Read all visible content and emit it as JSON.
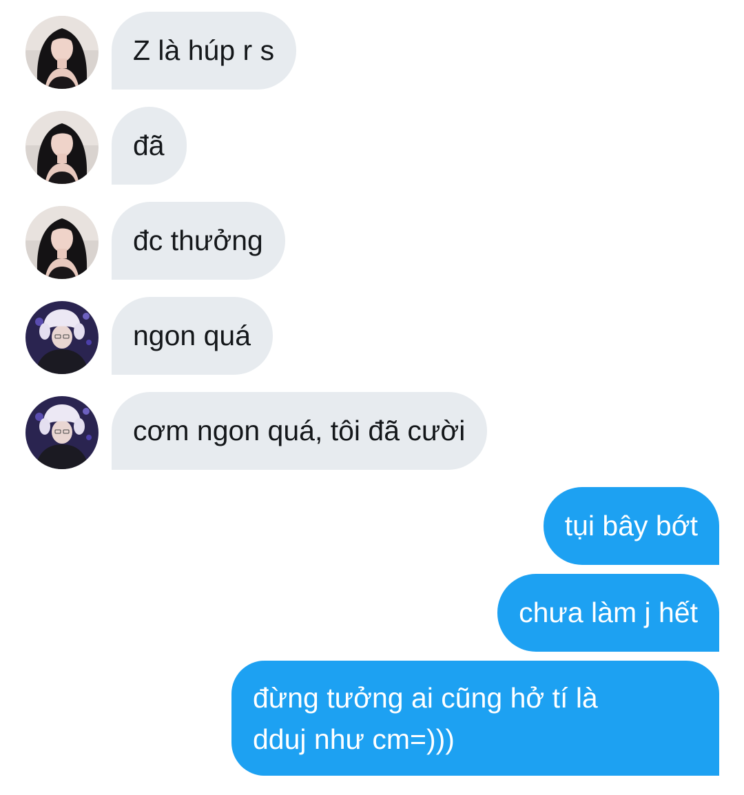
{
  "conversation": {
    "incoming": [
      {
        "avatar": "avatar-girl-black-hair",
        "text": "Z là húp r s"
      },
      {
        "avatar": "avatar-girl-black-hair",
        "text": "đã"
      },
      {
        "avatar": "avatar-girl-black-hair",
        "text": "đc thưởng"
      },
      {
        "avatar": "avatar-boy-white-fur-hat",
        "text": "ngon quá"
      },
      {
        "avatar": "avatar-boy-white-fur-hat",
        "text": "cơm ngon quá, tôi đã cười"
      }
    ],
    "outgoing": [
      {
        "lines": [
          "tụi bây bớt"
        ]
      },
      {
        "lines": [
          "chưa làm j hết"
        ]
      },
      {
        "lines": [
          "đừng tưởng ai cũng hở tí là",
          "dduj như cm=)))"
        ]
      }
    ]
  },
  "colors": {
    "background": "#ffffff",
    "incoming_bubble": "#e7ebef",
    "incoming_text": "#14171a",
    "outgoing_bubble": "#1da1f2",
    "outgoing_text": "#ffffff"
  }
}
